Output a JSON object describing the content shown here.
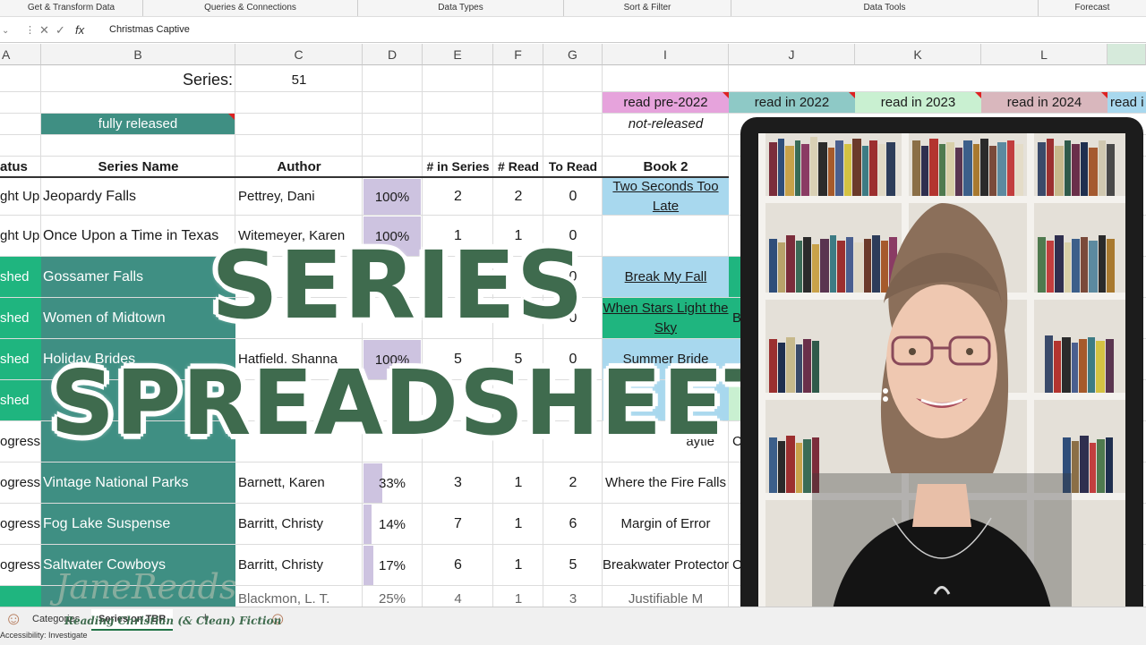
{
  "ribbon": {
    "groups": [
      "Get & Transform Data",
      "Queries & Connections",
      "Data Types",
      "Sort & Filter",
      "Data Tools",
      "Forecast"
    ]
  },
  "formula_bar": {
    "cancel": "✕",
    "enter": "✓",
    "fx": "fx",
    "value": "Christmas Captive"
  },
  "columns": [
    "A",
    "B",
    "C",
    "D",
    "E",
    "F",
    "G",
    "I",
    "J",
    "K",
    "L"
  ],
  "top_rows": {
    "series_label": "Series:",
    "series_count": "51",
    "legend_fully_released": "fully released",
    "legend_pre2022": "read pre-2022",
    "legend_2022": "read in 2022",
    "legend_2023": "read in 2023",
    "legend_2024": "read in 2024",
    "legend_next": "read i",
    "legend_not_released": "not-released"
  },
  "headers": {
    "status": "atus",
    "series_name": "Series Name",
    "author": "Author",
    "in_series": "# in Series",
    "read": "# Read",
    "to_read": "To Read",
    "book2": "Book 2"
  },
  "rows": [
    {
      "status": "ght Up",
      "series": "Jeopardy Falls",
      "author": "Pettrey, Dani",
      "pct": "100%",
      "in_series": "2",
      "read": "2",
      "to_read": "0",
      "book2": "Two Seconds Too Late",
      "extra": ""
    },
    {
      "status": "ght Up",
      "series": "Once Upon a Time in Texas",
      "author": "Witemeyer, Karen",
      "pct": "100%",
      "in_series": "1",
      "read": "1",
      "to_read": "0",
      "book2": "",
      "extra": ""
    },
    {
      "status": "shed",
      "series": "Gossamer Falls",
      "author": "",
      "pct": "",
      "in_series": "",
      "read": "",
      "to_read": "0",
      "book2": "Break My Fall",
      "extra": ""
    },
    {
      "status": "shed",
      "series": "Women of Midtown",
      "author": "",
      "pct": "",
      "in_series": "",
      "read": "",
      "to_read": "0",
      "book2": "When Stars Light the Sky",
      "extra": "B"
    },
    {
      "status": "shed",
      "series": "Holiday Brides",
      "author": "Hatfield, Shanna",
      "pct": "100%",
      "in_series": "5",
      "read": "5",
      "to_read": "0",
      "book2": "Summer Bride",
      "extra": ""
    },
    {
      "status": "shed",
      "series": "",
      "author": "",
      "pct": "",
      "in_series": "",
      "read": "",
      "to_read": "",
      "book2": "ge",
      "extra": ""
    },
    {
      "status": "ogress",
      "series": "",
      "author": "",
      "pct": "",
      "in_series": "",
      "read": "",
      "to_read": "",
      "book2": "aytie",
      "extra": "C"
    },
    {
      "status": "ogress",
      "series": "Vintage National Parks",
      "author": "Barnett, Karen",
      "pct": "33%",
      "in_series": "3",
      "read": "1",
      "to_read": "2",
      "book2": "Where the Fire Falls",
      "extra": ""
    },
    {
      "status": "ogress",
      "series": "Fog Lake Suspense",
      "author": "Barritt, Christy",
      "pct": "14%",
      "in_series": "7",
      "read": "1",
      "to_read": "6",
      "book2": "Margin of Error",
      "extra": ""
    },
    {
      "status": "ogress",
      "series": "Saltwater Cowboys",
      "author": "Barritt, Christy",
      "pct": "17%",
      "in_series": "6",
      "read": "1",
      "to_read": "5",
      "book2": "Breakwater Protector",
      "extra": "C"
    }
  ],
  "partial_row": {
    "author": "Blackmon, L. T.",
    "pct": "25%",
    "in_series": "4",
    "read": "1",
    "to_read": "3",
    "book2": "Justifiable M"
  },
  "overlay": {
    "line1": "SERIES",
    "line2": "SPREADSHEET"
  },
  "brand": {
    "name": "JaneReads",
    "tagline": "Reading Christian (& Clean) Fiction"
  },
  "sheet_tabs": [
    "Categories",
    "Series on TBR"
  ],
  "status_bar": "Accessibility: Investigate",
  "colors": {
    "teal": "#3f8f83",
    "green": "#1fb57f",
    "blue": "#a8d8ee",
    "pink": "#e6a3dc",
    "mint": "#c9f0d1",
    "mauve": "#d9b7bd",
    "title": "#3f6b4e"
  }
}
